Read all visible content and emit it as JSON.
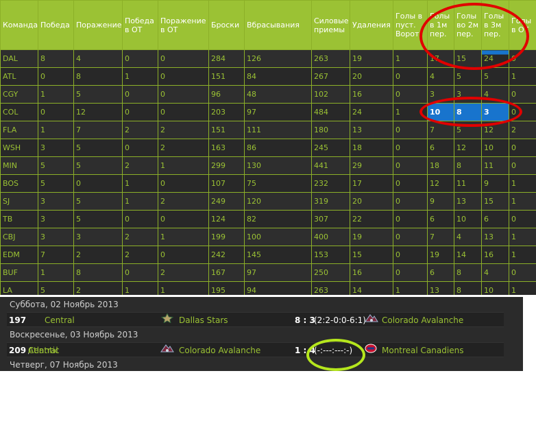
{
  "stats": {
    "headers": [
      "Команда",
      "Победа",
      "Поражение",
      "Победа в ОТ",
      "Поражение в ОТ",
      "Броски",
      "Вбрасывания",
      "Силовые приемы",
      "Удаления",
      "Голы в пуст. Ворот",
      "Голы в 1м пер.",
      "Голы во 2м пер.",
      "Голы в 3м пер.",
      "Голы в ОТ"
    ],
    "rows": [
      [
        "DAL",
        "8",
        "4",
        "0",
        "0",
        "284",
        "126",
        "263",
        "19",
        "1",
        "17",
        "15",
        "24",
        "0"
      ],
      [
        "ATL",
        "0",
        "8",
        "1",
        "0",
        "151",
        "84",
        "267",
        "20",
        "0",
        "4",
        "5",
        "5",
        "1"
      ],
      [
        "CGY",
        "1",
        "5",
        "0",
        "0",
        "96",
        "48",
        "102",
        "16",
        "0",
        "3",
        "3",
        "4",
        "0"
      ],
      [
        "COL",
        "0",
        "12",
        "0",
        "0",
        "203",
        "97",
        "484",
        "24",
        "1",
        "10",
        "8",
        "3",
        "0"
      ],
      [
        "FLA",
        "1",
        "7",
        "2",
        "2",
        "151",
        "111",
        "180",
        "13",
        "0",
        "7",
        "5",
        "12",
        "2"
      ],
      [
        "WSH",
        "3",
        "5",
        "0",
        "2",
        "163",
        "86",
        "245",
        "18",
        "0",
        "6",
        "12",
        "10",
        "0"
      ],
      [
        "MIN",
        "5",
        "5",
        "2",
        "1",
        "299",
        "130",
        "441",
        "29",
        "0",
        "18",
        "8",
        "11",
        "0"
      ],
      [
        "BOS",
        "5",
        "0",
        "1",
        "0",
        "107",
        "75",
        "232",
        "17",
        "0",
        "12",
        "11",
        "9",
        "1"
      ],
      [
        "SJ",
        "3",
        "5",
        "1",
        "2",
        "249",
        "120",
        "319",
        "20",
        "0",
        "9",
        "13",
        "15",
        "1"
      ],
      [
        "TB",
        "3",
        "5",
        "0",
        "0",
        "124",
        "82",
        "307",
        "22",
        "0",
        "6",
        "10",
        "6",
        "0"
      ],
      [
        "CBJ",
        "3",
        "3",
        "2",
        "1",
        "199",
        "100",
        "400",
        "19",
        "0",
        "7",
        "4",
        "13",
        "1"
      ],
      [
        "EDM",
        "7",
        "2",
        "2",
        "0",
        "242",
        "145",
        "153",
        "15",
        "0",
        "19",
        "14",
        "16",
        "1"
      ],
      [
        "BUF",
        "1",
        "8",
        "0",
        "2",
        "167",
        "97",
        "250",
        "16",
        "0",
        "6",
        "8",
        "4",
        "0"
      ],
      [
        "LA",
        "5",
        "2",
        "1",
        "1",
        "195",
        "94",
        "263",
        "14",
        "1",
        "13",
        "8",
        "10",
        "1"
      ]
    ],
    "highlighted_team": "COL"
  },
  "games": [
    {
      "date": "Суббота, 02 Ноябрь 2013",
      "id": "197",
      "conference": [
        "Central"
      ],
      "home": {
        "name": "Dallas Stars",
        "icon": "dallas-stars-logo"
      },
      "score": "8 : 3",
      "periods": "(2:2-0:0-6:1)",
      "away": {
        "name": "Colorado Avalanche",
        "icon": "colorado-avalanche-logo"
      }
    },
    {
      "date": "Воскресенье, 03 Ноябрь 2013",
      "id": "209",
      "conference": [
        "Central",
        "Atlantic"
      ],
      "home": {
        "name": "Colorado Avalanche",
        "icon": "colorado-avalanche-logo"
      },
      "score": "1 : 4",
      "periods": "(-:---:---:-)",
      "away": {
        "name": "Montreal Canadiens",
        "icon": "montreal-canadiens-logo"
      }
    },
    {
      "date": "Четверг, 07 Ноябрь 2013"
    }
  ],
  "colors": {
    "accent": "#9bc234",
    "highlight": "#1874cd",
    "annotation_red": "#e00000",
    "annotation_green": "#b5e61d"
  }
}
